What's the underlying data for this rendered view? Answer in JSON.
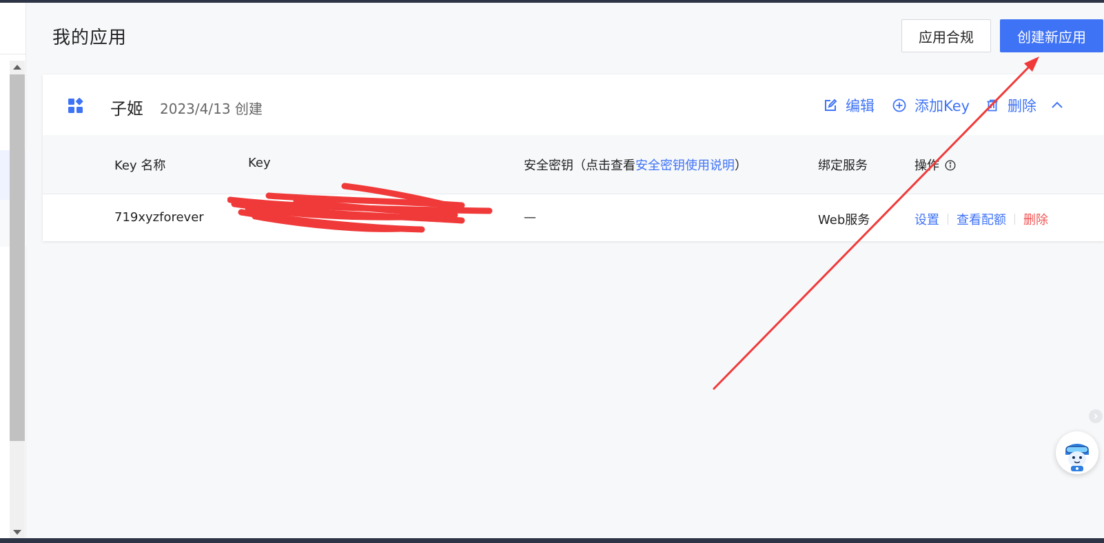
{
  "page": {
    "title": "我的应用"
  },
  "header": {
    "compliance_button": "应用合规",
    "create_button": "创建新应用"
  },
  "app": {
    "name": "子姬",
    "created": "2023/4/13 创建",
    "actions": {
      "edit": "编辑",
      "add_key": "添加Key",
      "delete": "删除"
    }
  },
  "table": {
    "headers": {
      "key_name": "Key 名称",
      "key": "Key",
      "secret_prefix": "安全密钥（点击查看",
      "secret_link": "安全密钥使用说明",
      "secret_suffix": "）",
      "service": "绑定服务",
      "ops": "操作"
    },
    "rows": [
      {
        "key_name": "719xyzforever",
        "secret": "—",
        "service": "Web服务",
        "ops": {
          "settings": "设置",
          "quota": "查看配额",
          "delete": "删除"
        }
      }
    ]
  },
  "colors": {
    "accent": "#3f73f5",
    "danger": "#f25353",
    "annotation": "#f03a3a",
    "topbar": "#2d3446"
  },
  "icons": [
    "app-grid-icon",
    "edit-icon",
    "plus-circle-icon",
    "trash-icon",
    "chevron-up-icon",
    "info-icon",
    "chevron-right-icon",
    "assistant-avatar-icon"
  ]
}
